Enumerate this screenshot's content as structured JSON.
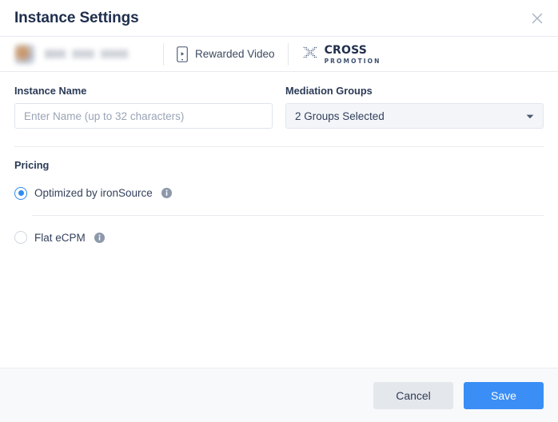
{
  "header": {
    "title": "Instance Settings",
    "close_icon": "close-icon"
  },
  "app_bar": {
    "app_name_redacted": "",
    "ad_unit": {
      "icon": "phone-rewarded-video-icon",
      "label": "Rewarded Video"
    },
    "network": {
      "icon": "cross-promotion-x-icon",
      "title": "CROSS",
      "subtitle": "PROMOTION"
    }
  },
  "form": {
    "instance_name": {
      "label": "Instance Name",
      "placeholder": "Enter Name (up to 32 characters)",
      "value": ""
    },
    "mediation_groups": {
      "label": "Mediation Groups",
      "selected": "2 Groups Selected",
      "caret_icon": "chevron-down-icon"
    }
  },
  "pricing": {
    "section_title": "Pricing",
    "options": [
      {
        "label": "Optimized by ironSource",
        "selected": true,
        "info_icon": "info-icon"
      },
      {
        "label": "Flat eCPM",
        "selected": false,
        "info_icon": "info-icon"
      }
    ]
  },
  "footer": {
    "cancel_label": "Cancel",
    "save_label": "Save"
  },
  "colors": {
    "accent_blue": "#3a8ef6",
    "radio_blue": "#2f8bf0",
    "title_navy": "#1f2e4d",
    "text_slate": "#34415c",
    "border": "#e7eaef",
    "footer_bg": "#f8f9fb",
    "select_bg": "#f3f5f8"
  }
}
